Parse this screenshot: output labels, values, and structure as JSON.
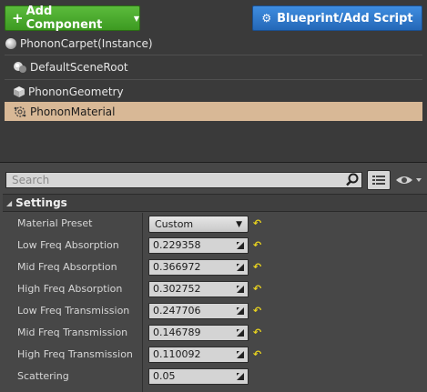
{
  "toolbar": {
    "add_component_label": "Add Component",
    "blueprint_label": "Blueprint/Add Script"
  },
  "tree": {
    "items": [
      {
        "label": "PhononCarpet(Instance)",
        "icon": "sphere-icon"
      },
      {
        "label": "DefaultSceneRoot",
        "icon": "scene-root-icon"
      },
      {
        "label": "PhononGeometry",
        "icon": "cube-icon"
      },
      {
        "label": "PhononMaterial",
        "icon": "material-icon",
        "selected": true
      }
    ]
  },
  "details": {
    "search_placeholder": "Search",
    "section_title": "Settings",
    "properties": [
      {
        "label": "Material Preset",
        "value": "Custom",
        "type": "combo"
      },
      {
        "label": "Low Freq Absorption",
        "value": "0.229358"
      },
      {
        "label": "Mid Freq Absorption",
        "value": "0.366972"
      },
      {
        "label": "High Freq Absorption",
        "value": "0.302752"
      },
      {
        "label": "Low Freq Transmission",
        "value": "0.247706"
      },
      {
        "label": "Mid Freq Transmission",
        "value": "0.146789"
      },
      {
        "label": "High Freq Transmission",
        "value": "0.110092"
      },
      {
        "label": "Scattering",
        "value": "0.05"
      }
    ]
  },
  "colors": {
    "add_button": "#4caf32",
    "blueprint_button": "#2f7ad0",
    "selected_row": "#d8b896",
    "reset_arrow": "#e8d21f"
  }
}
